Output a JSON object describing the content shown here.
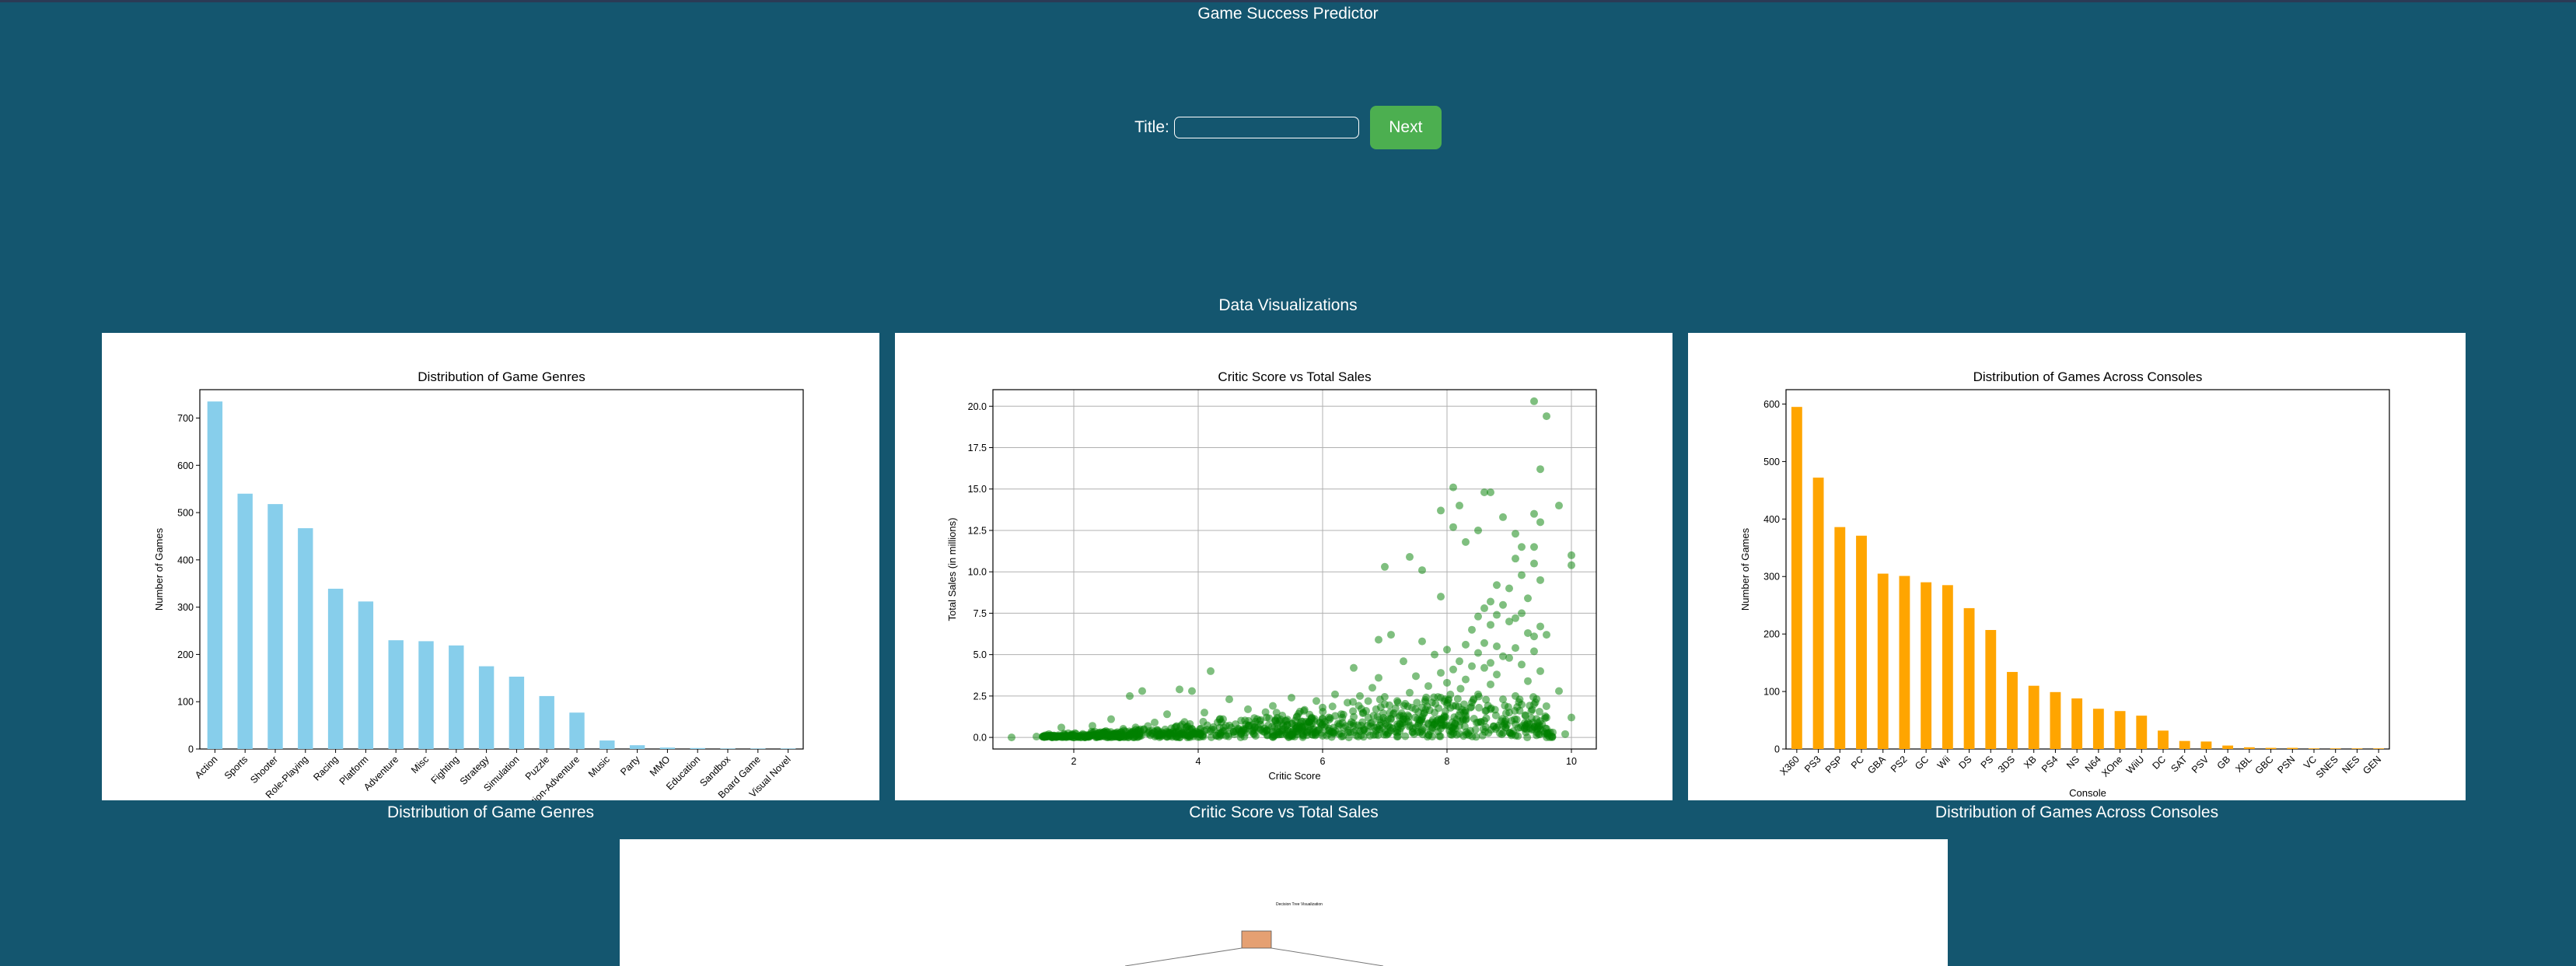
{
  "app": {
    "title": "Game Success Predictor"
  },
  "form": {
    "title_label": "Title:",
    "title_value": "",
    "next_label": "Next"
  },
  "viz": {
    "section_title": "Data Visualizations",
    "captions": [
      "Distribution of Game Genres",
      "Critic Score vs Total Sales",
      "Distribution of Games Across Consoles"
    ],
    "tree_title": "Decision Tree Visualization"
  },
  "chart_data": [
    {
      "type": "bar",
      "title": "Distribution of Game Genres",
      "xlabel": "",
      "ylabel": "Number of Games",
      "categories": [
        "Action",
        "Sports",
        "Shooter",
        "Role-Playing",
        "Racing",
        "Platform",
        "Adventure",
        "Misc",
        "Fighting",
        "Strategy",
        "Simulation",
        "Puzzle",
        "Action-Adventure",
        "Music",
        "Party",
        "MMO",
        "Education",
        "Sandbox",
        "Board Game",
        "Visual Novel"
      ],
      "values": [
        735,
        540,
        518,
        467,
        339,
        312,
        230,
        228,
        219,
        175,
        153,
        112,
        77,
        18,
        8,
        3,
        2,
        1,
        1,
        1
      ],
      "ylim": [
        0,
        760
      ],
      "yticks": [
        0,
        100,
        200,
        300,
        400,
        500,
        600,
        700
      ],
      "color": "#87ceeb",
      "grid": false
    },
    {
      "type": "scatter",
      "title": "Critic Score vs Total Sales",
      "xlabel": "Critic Score",
      "ylabel": "Total Sales (in millions)",
      "xlim": [
        0.7,
        10.4
      ],
      "ylim": [
        -0.7,
        21.0
      ],
      "xticks": [
        2,
        4,
        6,
        8,
        10
      ],
      "yticks": [
        0,
        2.5,
        5,
        7.5,
        10,
        12.5,
        15,
        17.5,
        20
      ],
      "ytick_labels": [
        "0.0",
        "2.5",
        "5.0",
        "7.5",
        "10.0",
        "12.5",
        "15.0",
        "17.5",
        "20.0"
      ],
      "color": "#008000",
      "grid": true,
      "points": [
        [
          9.4,
          20.3
        ],
        [
          9.6,
          19.4
        ],
        [
          9.5,
          16.2
        ],
        [
          8.1,
          15.1
        ],
        [
          8.6,
          14.8
        ],
        [
          8.7,
          14.8
        ],
        [
          8.2,
          14.0
        ],
        [
          9.8,
          14.0
        ],
        [
          7.9,
          13.7
        ],
        [
          9.4,
          13.5
        ],
        [
          8.9,
          13.3
        ],
        [
          9.5,
          13.0
        ],
        [
          8.1,
          12.7
        ],
        [
          8.5,
          12.5
        ],
        [
          9.1,
          12.3
        ],
        [
          8.3,
          11.8
        ],
        [
          9.2,
          11.5
        ],
        [
          9.4,
          11.5
        ],
        [
          10.0,
          11.0
        ],
        [
          7.4,
          10.9
        ],
        [
          9.1,
          10.8
        ],
        [
          9.4,
          10.5
        ],
        [
          7.0,
          10.3
        ],
        [
          7.6,
          10.1
        ],
        [
          10.0,
          10.4
        ],
        [
          9.2,
          9.8
        ],
        [
          9.5,
          9.5
        ],
        [
          8.8,
          9.2
        ],
        [
          9.0,
          9.0
        ],
        [
          7.9,
          8.5
        ],
        [
          9.3,
          8.4
        ],
        [
          8.7,
          8.2
        ],
        [
          8.9,
          8.0
        ],
        [
          8.6,
          7.8
        ],
        [
          8.8,
          7.4
        ],
        [
          9.2,
          7.5
        ],
        [
          8.5,
          7.3
        ],
        [
          9.1,
          7.2
        ],
        [
          9.0,
          7.0
        ],
        [
          8.7,
          6.8
        ],
        [
          9.5,
          6.7
        ],
        [
          8.4,
          6.5
        ],
        [
          9.3,
          6.3
        ],
        [
          9.4,
          6.1
        ],
        [
          9.6,
          6.2
        ],
        [
          7.1,
          6.2
        ],
        [
          6.9,
          5.9
        ],
        [
          7.6,
          5.8
        ],
        [
          8.6,
          5.7
        ],
        [
          8.3,
          5.6
        ],
        [
          8.8,
          5.5
        ],
        [
          9.1,
          5.4
        ],
        [
          8.0,
          5.3
        ],
        [
          9.4,
          5.2
        ],
        [
          8.5,
          5.1
        ],
        [
          7.8,
          5.0
        ],
        [
          8.9,
          4.9
        ],
        [
          9.0,
          4.8
        ],
        [
          8.2,
          4.6
        ],
        [
          8.7,
          4.5
        ],
        [
          7.3,
          4.6
        ],
        [
          9.2,
          4.4
        ],
        [
          8.4,
          4.3
        ],
        [
          8.6,
          4.2
        ],
        [
          8.1,
          4.1
        ],
        [
          9.5,
          4.0
        ],
        [
          7.9,
          3.9
        ],
        [
          8.8,
          3.8
        ],
        [
          4.2,
          4.0
        ],
        [
          6.5,
          4.2
        ],
        [
          6.9,
          3.6
        ],
        [
          7.5,
          3.7
        ],
        [
          8.3,
          3.5
        ],
        [
          9.3,
          3.4
        ],
        [
          8.0,
          3.3
        ],
        [
          8.7,
          3.2
        ],
        [
          7.7,
          3.1
        ],
        [
          6.8,
          3.0
        ],
        [
          3.7,
          2.9
        ],
        [
          3.9,
          2.8
        ],
        [
          3.1,
          2.8
        ],
        [
          9.8,
          2.8
        ],
        [
          6.2,
          2.6
        ],
        [
          7.4,
          2.7
        ],
        [
          8.5,
          2.6
        ],
        [
          9.1,
          2.5
        ],
        [
          6.6,
          2.5
        ],
        [
          2.9,
          2.5
        ],
        [
          5.5,
          2.4
        ],
        [
          7.9,
          2.4
        ],
        [
          8.9,
          2.3
        ],
        [
          4.5,
          2.3
        ],
        [
          5.9,
          2.2
        ],
        [
          7.2,
          2.2
        ],
        [
          8.4,
          2.1
        ],
        [
          6.4,
          2.1
        ],
        [
          9.4,
          2.0
        ],
        [
          7.0,
          2.0
        ],
        [
          5.2,
          1.9
        ],
        [
          8.1,
          1.9
        ],
        [
          6.0,
          1.8
        ],
        [
          7.6,
          1.8
        ],
        [
          8.7,
          1.7
        ],
        [
          4.8,
          1.7
        ],
        [
          6.7,
          1.6
        ],
        [
          5.7,
          1.6
        ],
        [
          7.8,
          1.5
        ],
        [
          9.0,
          1.5
        ],
        [
          4.1,
          1.5
        ],
        [
          6.3,
          1.4
        ],
        [
          3.5,
          1.4
        ],
        [
          7.3,
          1.3
        ],
        [
          8.3,
          1.3
        ],
        [
          5.1,
          1.2
        ],
        [
          9.6,
          1.2
        ],
        [
          6.1,
          1.2
        ],
        [
          2.6,
          1.1
        ],
        [
          4.4,
          1.1
        ],
        [
          7.1,
          1.1
        ],
        [
          8.6,
          1.0
        ],
        [
          5.4,
          1.0
        ],
        [
          3.3,
          0.9
        ],
        [
          6.8,
          0.9
        ],
        [
          9.3,
          0.9
        ],
        [
          4.6,
          0.8
        ],
        [
          7.7,
          0.8
        ],
        [
          2.3,
          0.7
        ],
        [
          5.8,
          0.7
        ],
        [
          8.9,
          0.7
        ],
        [
          10.0,
          1.2
        ],
        [
          1.0,
          0.0
        ],
        [
          1.6,
          0.2
        ],
        [
          1.4,
          0.05
        ],
        [
          1.5,
          0.05
        ],
        [
          1.8,
          0.6
        ],
        [
          2.1,
          0.1
        ],
        [
          2.0,
          0.0
        ],
        [
          2.4,
          0.1
        ],
        [
          2.7,
          0.2
        ],
        [
          3.0,
          0.1
        ],
        [
          3.2,
          0.3
        ],
        [
          3.4,
          0.15
        ],
        [
          3.6,
          0.1
        ],
        [
          3.8,
          0.2
        ],
        [
          4.0,
          0.3
        ],
        [
          4.3,
          0.1
        ],
        [
          4.7,
          0.4
        ],
        [
          4.9,
          0.2
        ],
        [
          5.0,
          0.5
        ],
        [
          5.3,
          0.3
        ],
        [
          5.6,
          0.6
        ],
        [
          6.2,
          0.4
        ],
        [
          6.5,
          0.7
        ],
        [
          6.9,
          0.5
        ],
        [
          7.2,
          0.8
        ],
        [
          7.5,
          0.6
        ],
        [
          7.9,
          0.9
        ],
        [
          8.2,
          0.7
        ],
        [
          8.5,
          0.9
        ],
        [
          8.8,
          0.6
        ],
        [
          9.1,
          0.8
        ],
        [
          9.5,
          0.5
        ],
        [
          9.7,
          0.3
        ],
        [
          9.9,
          0.2
        ]
      ]
    },
    {
      "type": "bar",
      "title": "Distribution of Games Across Consoles",
      "xlabel": "Console",
      "ylabel": "Number of Games",
      "categories": [
        "X360",
        "PS3",
        "PSP",
        "PC",
        "GBA",
        "PS2",
        "GC",
        "Wii",
        "DS",
        "PS",
        "3DS",
        "XB",
        "PS4",
        "NS",
        "N64",
        "XOne",
        "WiiU",
        "DC",
        "SAT",
        "PSV",
        "GB",
        "XBL",
        "GBC",
        "PSN",
        "VC",
        "SNES",
        "NES",
        "GEN"
      ],
      "values": [
        595,
        472,
        386,
        371,
        305,
        301,
        290,
        285,
        245,
        207,
        134,
        110,
        99,
        88,
        70,
        66,
        58,
        32,
        14,
        13,
        6,
        3,
        2,
        2,
        1,
        1,
        1,
        1
      ],
      "ylim": [
        0,
        625
      ],
      "yticks": [
        0,
        100,
        200,
        300,
        400,
        500,
        600
      ],
      "color": "#ffa500",
      "grid": false
    }
  ]
}
